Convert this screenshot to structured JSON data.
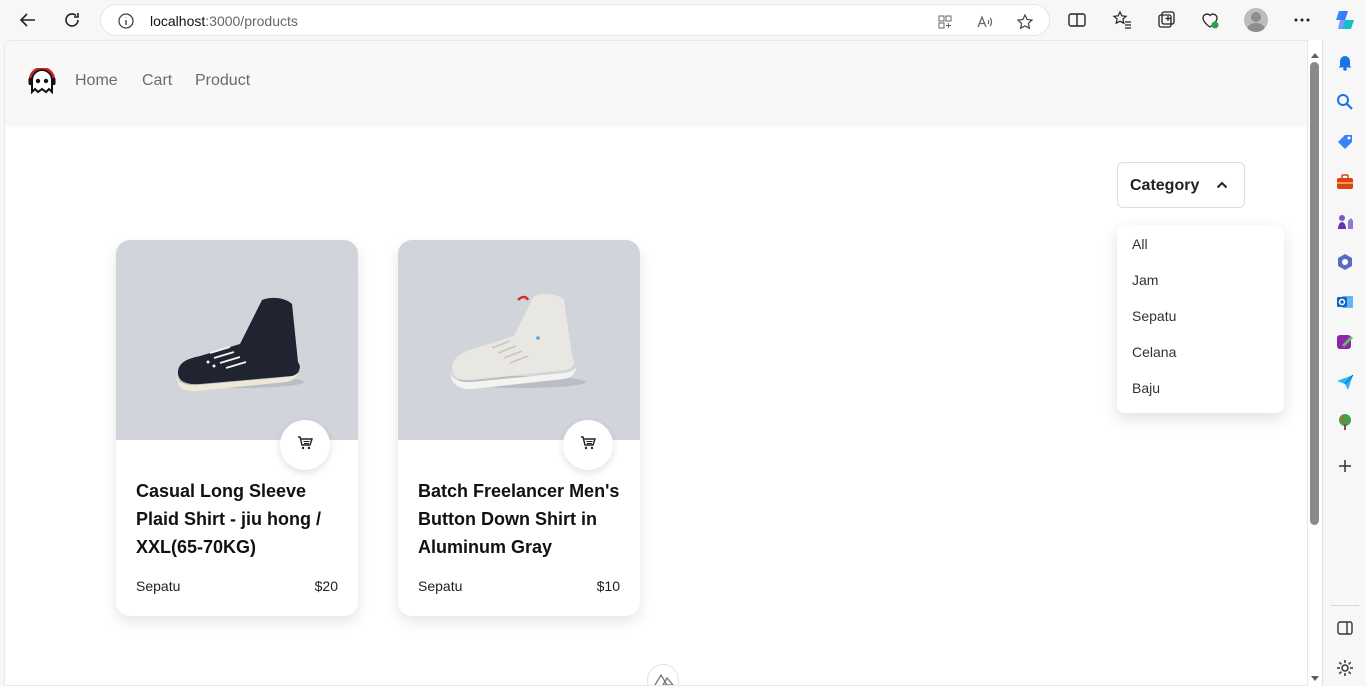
{
  "browser": {
    "url_host": "localhost",
    "url_path": ":3000/products"
  },
  "nav": {
    "links": [
      "Home",
      "Cart",
      "Product"
    ]
  },
  "category": {
    "button_label": "Category",
    "options": [
      "All",
      "Jam",
      "Sepatu",
      "Celana",
      "Baju"
    ]
  },
  "products": [
    {
      "title": "Casual Long Sleeve Plaid Shirt - jiu hong / XXL(65-70KG)",
      "category": "Sepatu",
      "price": "$20",
      "shoe_color": "#1f2430"
    },
    {
      "title": "Batch Freelancer Men's Button Down Shirt in Aluminum Gray",
      "category": "Sepatu",
      "price": "$10",
      "shoe_color": "#e9e7e2"
    }
  ],
  "colors": {
    "card_image_bg": "#d1d5db",
    "nav_link": "#6b6b6b"
  }
}
